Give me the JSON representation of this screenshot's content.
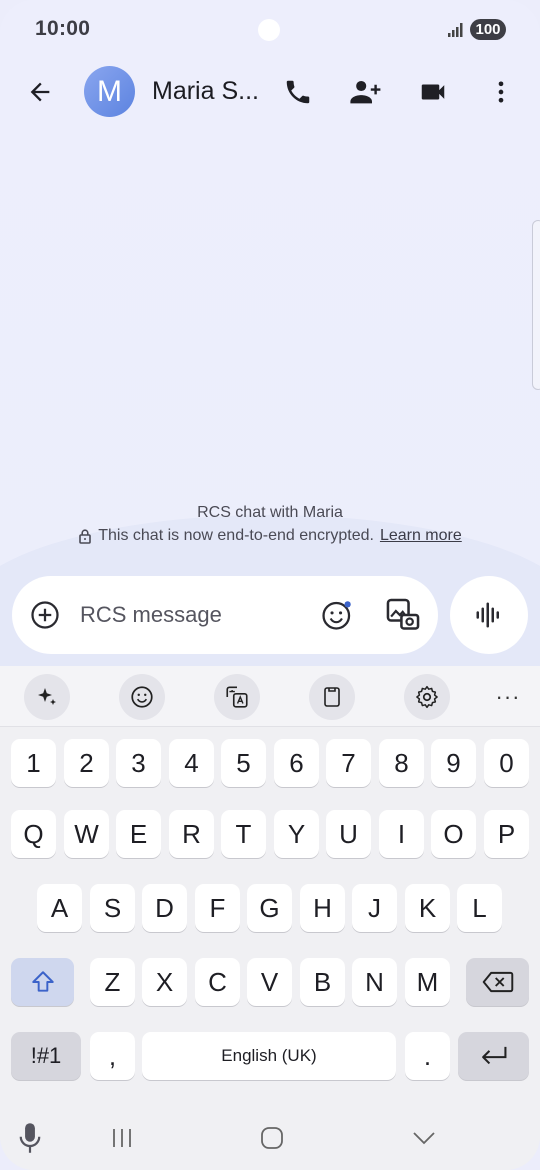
{
  "status_bar": {
    "time": "10:00",
    "battery": "100"
  },
  "app_bar": {
    "avatar_initial": "M",
    "contact_name": "Maria S..."
  },
  "conversation": {
    "title": "RCS chat with Maria",
    "encryption_text": "This chat is now end-to-end encrypted.",
    "learn_more": "Learn more"
  },
  "compose": {
    "placeholder": "RCS message"
  },
  "keyboard": {
    "number_row": [
      "1",
      "2",
      "3",
      "4",
      "5",
      "6",
      "7",
      "8",
      "9",
      "0"
    ],
    "row1": [
      "Q",
      "W",
      "E",
      "R",
      "T",
      "Y",
      "U",
      "I",
      "O",
      "P"
    ],
    "row2": [
      "A",
      "S",
      "D",
      "F",
      "G",
      "H",
      "J",
      "K",
      "L"
    ],
    "row3": [
      "Z",
      "X",
      "C",
      "V",
      "B",
      "N",
      "M"
    ],
    "symbols_key": "!#1",
    "comma_key": ",",
    "space_label": "English (UK)",
    "period_key": ".",
    "more_tools": "···"
  },
  "colors": {
    "accent": "#5c83e0",
    "background": "#ecedfb",
    "shift_key": "#cfd7ee"
  }
}
